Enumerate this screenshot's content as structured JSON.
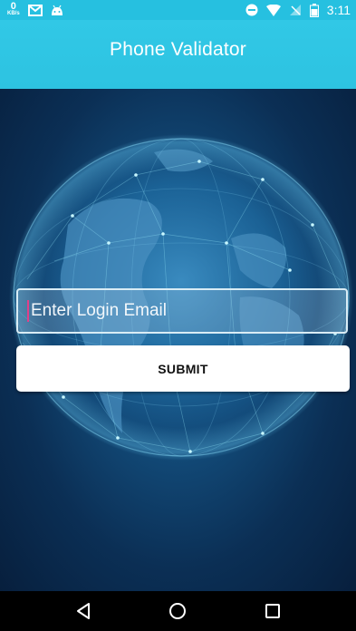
{
  "status_bar": {
    "speed_value": "0",
    "speed_unit": "KB/s",
    "time": "3:11",
    "icons": [
      "mail-icon",
      "android-icon",
      "do-not-disturb-icon",
      "wifi-icon",
      "no-signal-icon",
      "battery-icon"
    ]
  },
  "app_bar": {
    "title": "Phone Validator"
  },
  "login": {
    "email_placeholder": "Enter Login Email",
    "email_value": "",
    "submit_label": "SUBMIT"
  },
  "nav_bar": {
    "icons": [
      "back-icon",
      "home-icon",
      "recents-icon"
    ]
  },
  "colors": {
    "accent": "#2dc3e1",
    "background_dark": "#0b2f55",
    "caret": "#e0408a"
  }
}
